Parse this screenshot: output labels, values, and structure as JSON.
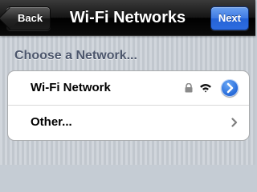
{
  "navbar": {
    "title": "Wi-Fi Networks",
    "back_label": "Back",
    "next_label": "Next"
  },
  "section": {
    "header": "Choose a Network..."
  },
  "networks": [
    {
      "label": "Wi-Fi Network",
      "icons": [
        "lock-icon",
        "wifi-icon",
        "detail-disclosure-icon"
      ]
    },
    {
      "label": "Other...",
      "icons": [
        "chevron-right-icon"
      ]
    }
  ],
  "colors": {
    "navbar": "#000000",
    "next_button": "#2f6fe0",
    "section_header": "#4c566c",
    "background": "#c7cdd5"
  }
}
